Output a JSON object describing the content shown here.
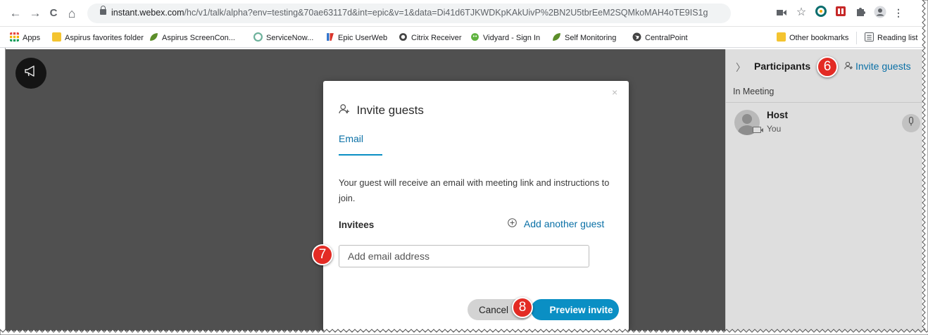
{
  "browser": {
    "url_host": "instant.webex.com",
    "url_path": "/hc/v1/talk/alpha?env=testing&70ae63117d&int=epic&v=1&data=Di41d6TJKWDKpKAkUivP%2BN2U5tbrEeM2SQMkoMAH4oTE9IS1g",
    "nav": {
      "back": "←",
      "forward": "→",
      "reload": "C",
      "home": "⌂"
    },
    "extensions": [
      "camera-icon",
      "star-icon",
      "circle-extension-icon",
      "red-extension-icon",
      "puzzle-icon",
      "profile-icon",
      "menu-icon"
    ]
  },
  "bookmarks": {
    "items": [
      {
        "label": "Apps",
        "icon": "apps-grid-icon",
        "color": "#e8453c"
      },
      {
        "label": "Aspirus favorites folder",
        "icon": "folder-icon",
        "color": "#f4c430"
      },
      {
        "label": "Aspirus ScreenCon...",
        "icon": "leaf-icon",
        "color": "#5c8e2a"
      },
      {
        "label": "ServiceNow...",
        "icon": "servicenow-icon",
        "color": "#6bb09a"
      },
      {
        "label": "Epic UserWeb",
        "icon": "epic-icon",
        "color": "#d9342b"
      },
      {
        "label": "Citrix Receiver",
        "icon": "citrix-icon",
        "color": "#444444"
      },
      {
        "label": "Vidyard - Sign In",
        "icon": "vidyard-icon",
        "color": "#5fb33f"
      },
      {
        "label": "Self Monitoring",
        "icon": "leaf-icon",
        "color": "#5c8e2a"
      },
      {
        "label": "CentralPoint",
        "icon": "globe-icon",
        "color": "#444444"
      }
    ],
    "other": "Other bookmarks",
    "reading": "Reading list"
  },
  "panel": {
    "title": "Participants",
    "invite_label": "Invite guests",
    "section": "In Meeting",
    "participant": {
      "name": "Host",
      "sub": "You"
    }
  },
  "dialog": {
    "title": "Invite guests",
    "tab": "Email",
    "description": "Your guest will receive an email with meeting link and instructions to join.",
    "invitees_label": "Invitees",
    "add_guest": "Add another guest",
    "email_placeholder": "Add email address",
    "cancel": "Cancel",
    "preview": "Preview invite",
    "close": "×"
  },
  "callouts": {
    "six": "6",
    "seven": "7",
    "eight": "8"
  },
  "colors": {
    "accent": "#0a8fc4",
    "link": "#0a70a6",
    "callout": "#e32b24",
    "stage": "#505050",
    "panel": "#dedede"
  }
}
